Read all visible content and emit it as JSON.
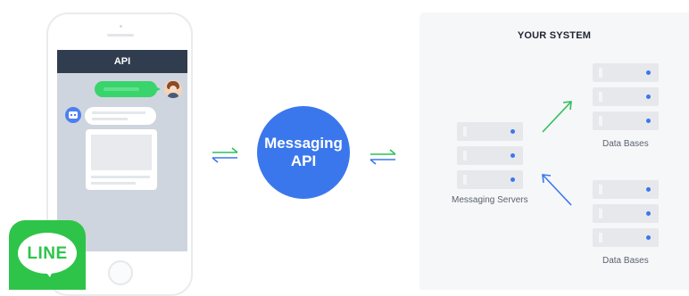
{
  "phone": {
    "screen_title": "API"
  },
  "logo": {
    "text": "LINE",
    "color": "#2ec449"
  },
  "api": {
    "line1": "Messaging",
    "line2": "API",
    "color": "#3b77ec"
  },
  "system": {
    "title": "YOUR SYSTEM",
    "messaging_servers_label": "Messaging Servers",
    "database_top_label": "Data Bases",
    "database_bottom_label": "Data Bases"
  },
  "colors": {
    "arrow_green": "#2fbf5b",
    "arrow_blue": "#3b77ec",
    "chat_header": "#2f3d4f",
    "chat_bg": "#cfd5de"
  },
  "icons": {
    "user": "user-avatar-icon",
    "bot": "bot-avatar-icon",
    "exchange": "bidirectional-arrows-icon",
    "server": "server-icon"
  }
}
